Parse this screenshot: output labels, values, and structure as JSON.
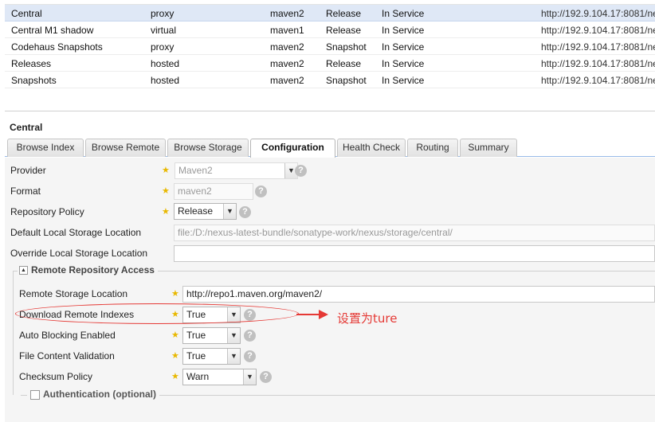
{
  "grid": {
    "rows": [
      {
        "name": "Central",
        "type": "proxy",
        "format": "maven2",
        "policy": "Release",
        "status": "In Service",
        "url": "http://192.9.104.17:8081/ne",
        "selected": true
      },
      {
        "name": "Central M1 shadow",
        "type": "virtual",
        "format": "maven1",
        "policy": "Release",
        "status": "In Service",
        "url": "http://192.9.104.17:8081/ne",
        "selected": false
      },
      {
        "name": "Codehaus Snapshots",
        "type": "proxy",
        "format": "maven2",
        "policy": "Snapshot",
        "status": "In Service",
        "url": "http://192.9.104.17:8081/ne",
        "selected": false
      },
      {
        "name": "Releases",
        "type": "hosted",
        "format": "maven2",
        "policy": "Release",
        "status": "In Service",
        "url": "http://192.9.104.17:8081/ne",
        "selected": false
      },
      {
        "name": "Snapshots",
        "type": "hosted",
        "format": "maven2",
        "policy": "Snapshot",
        "status": "In Service",
        "url": "http://192.9.104.17:8081/ne",
        "selected": false
      }
    ]
  },
  "panel": {
    "title": "Central",
    "tabs": [
      {
        "label": "Browse Index",
        "active": false
      },
      {
        "label": "Browse Remote",
        "active": false
      },
      {
        "label": "Browse Storage",
        "active": false
      },
      {
        "label": "Configuration",
        "active": true
      },
      {
        "label": "Health Check",
        "active": false
      },
      {
        "label": "Routing",
        "active": false
      },
      {
        "label": "Summary",
        "active": false
      }
    ]
  },
  "form": {
    "provider": {
      "label": "Provider",
      "value": "Maven2"
    },
    "format": {
      "label": "Format",
      "value": "maven2"
    },
    "repository_policy": {
      "label": "Repository Policy",
      "value": "Release"
    },
    "default_storage": {
      "label": "Default Local Storage Location",
      "value": "file:/D:/nexus-latest-bundle/sonatype-work/nexus/storage/central/"
    },
    "override_storage": {
      "label": "Override Local Storage Location",
      "value": ""
    },
    "remote_access": {
      "legend": "Remote Repository Access",
      "remote_location": {
        "label": "Remote Storage Location",
        "value": "http://repo1.maven.org/maven2/"
      },
      "download_indexes": {
        "label": "Download Remote Indexes",
        "value": "True"
      },
      "auto_blocking": {
        "label": "Auto Blocking Enabled",
        "value": "True"
      },
      "content_validation": {
        "label": "File Content Validation",
        "value": "True"
      },
      "checksum_policy": {
        "label": "Checksum Policy",
        "value": "Warn"
      }
    },
    "authentication": {
      "legend": "Authentication (optional)"
    }
  },
  "annotation": {
    "text": "设置为ture",
    "color": "#e53935"
  },
  "icons": {
    "required": "star-icon",
    "help": "help-icon",
    "dropdown": "chevron-down-icon"
  }
}
